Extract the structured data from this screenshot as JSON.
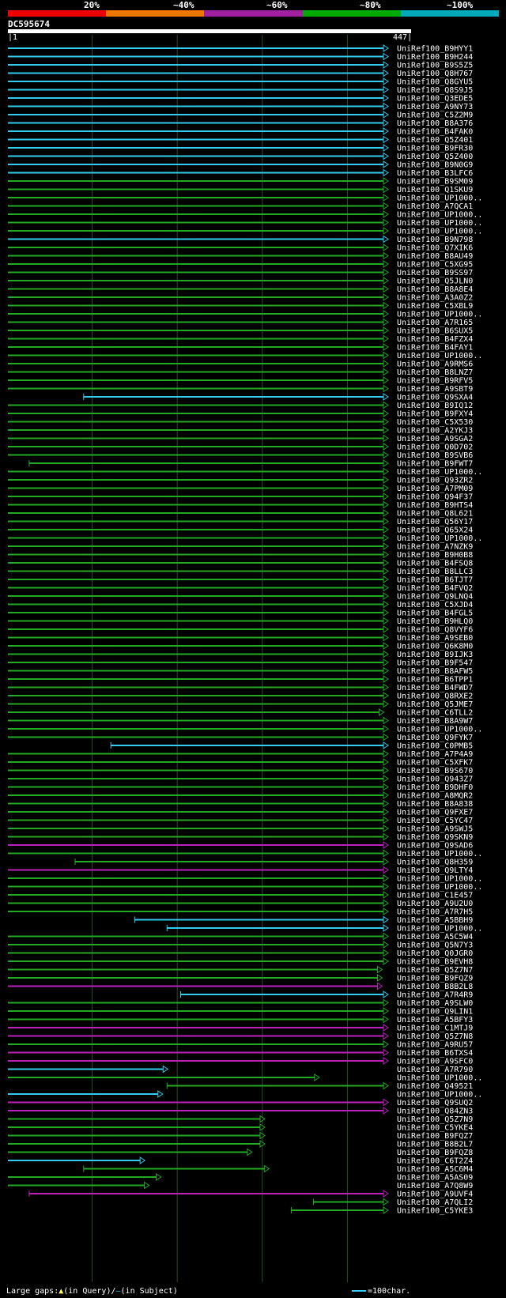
{
  "legend": {
    "labels": [
      "20%",
      "~40%",
      "~60%",
      "~80%",
      "~100%"
    ],
    "colors": [
      "#ee0000",
      "#ee7700",
      "#a020a0",
      "#00aa00",
      "#00aabb"
    ]
  },
  "query": {
    "name": "DC595674",
    "start": "1",
    "end": "447"
  },
  "footer": {
    "gaps_prefix": "Large gaps:",
    "query_marker": "▲",
    "query_text": "(in Query)/",
    "subject_marker": "–",
    "subject_text": "(in Subject)",
    "scale_text": "=100char."
  },
  "chart_data": {
    "type": "alignment-map",
    "query_length": 447,
    "x_ticks": [
      1,
      100,
      200,
      300,
      400,
      447
    ],
    "identity_colors": {
      "cyan": "#33ccee",
      "green": "#22aa22",
      "magenta": "#bb22bb"
    },
    "hits": [
      {
        "name": "UniRef100_B9HYY1",
        "start": 1,
        "end": 447,
        "color": "cyan"
      },
      {
        "name": "UniRef100_B9H244",
        "start": 1,
        "end": 447,
        "color": "cyan"
      },
      {
        "name": "UniRef100_B9S5Z5",
        "start": 1,
        "end": 447,
        "color": "cyan"
      },
      {
        "name": "UniRef100_Q8H767",
        "start": 1,
        "end": 447,
        "color": "cyan"
      },
      {
        "name": "UniRef100_Q8GYU5",
        "start": 1,
        "end": 447,
        "color": "cyan"
      },
      {
        "name": "UniRef100_Q8S9J5",
        "start": 1,
        "end": 447,
        "color": "cyan"
      },
      {
        "name": "UniRef100_Q3EDE5",
        "start": 1,
        "end": 447,
        "color": "cyan"
      },
      {
        "name": "UniRef100_A9NY73",
        "start": 1,
        "end": 447,
        "color": "cyan"
      },
      {
        "name": "UniRef100_C5Z2M9",
        "start": 1,
        "end": 447,
        "color": "cyan"
      },
      {
        "name": "UniRef100_B8A376",
        "start": 1,
        "end": 447,
        "color": "cyan"
      },
      {
        "name": "UniRef100_B4FAK0",
        "start": 1,
        "end": 447,
        "color": "cyan"
      },
      {
        "name": "UniRef100_Q5Z401",
        "start": 1,
        "end": 447,
        "color": "cyan"
      },
      {
        "name": "UniRef100_B9FR30",
        "start": 1,
        "end": 447,
        "color": "cyan"
      },
      {
        "name": "UniRef100_Q5Z400",
        "start": 1,
        "end": 447,
        "color": "cyan"
      },
      {
        "name": "UniRef100_B9N0G9",
        "start": 1,
        "end": 447,
        "color": "cyan"
      },
      {
        "name": "UniRef100_B3LFC6",
        "start": 1,
        "end": 447,
        "color": "cyan"
      },
      {
        "name": "UniRef100_B9SM09",
        "start": 1,
        "end": 447,
        "color": "green"
      },
      {
        "name": "UniRef100_Q1SKU9",
        "start": 1,
        "end": 447,
        "color": "green"
      },
      {
        "name": "UniRef100_UP1000..",
        "start": 1,
        "end": 447,
        "color": "green"
      },
      {
        "name": "UniRef100_A7QCA1",
        "start": 1,
        "end": 447,
        "color": "green"
      },
      {
        "name": "UniRef100_UP1000..",
        "start": 1,
        "end": 447,
        "color": "green"
      },
      {
        "name": "UniRef100_UP1000..",
        "start": 1,
        "end": 447,
        "color": "green"
      },
      {
        "name": "UniRef100_UP1000..",
        "start": 1,
        "end": 447,
        "color": "green"
      },
      {
        "name": "UniRef100_B9N798",
        "start": 1,
        "end": 447,
        "color": "cyan"
      },
      {
        "name": "UniRef100_Q7XIK6",
        "start": 1,
        "end": 447,
        "color": "green"
      },
      {
        "name": "UniRef100_B8AU49",
        "start": 1,
        "end": 447,
        "color": "green"
      },
      {
        "name": "UniRef100_C5XG95",
        "start": 1,
        "end": 447,
        "color": "green"
      },
      {
        "name": "UniRef100_B9SS97",
        "start": 1,
        "end": 447,
        "color": "green"
      },
      {
        "name": "UniRef100_Q5JLN0",
        "start": 1,
        "end": 447,
        "color": "green"
      },
      {
        "name": "UniRef100_B8A8E4",
        "start": 1,
        "end": 447,
        "color": "green"
      },
      {
        "name": "UniRef100_A3A0Z2",
        "start": 1,
        "end": 447,
        "color": "green"
      },
      {
        "name": "UniRef100_C5XBL9",
        "start": 1,
        "end": 447,
        "color": "green"
      },
      {
        "name": "UniRef100_UP1000..",
        "start": 1,
        "end": 447,
        "color": "green"
      },
      {
        "name": "UniRef100_A7R165",
        "start": 1,
        "end": 447,
        "color": "green"
      },
      {
        "name": "UniRef100_B6SUX5",
        "start": 1,
        "end": 447,
        "color": "green"
      },
      {
        "name": "UniRef100_B4FZX4",
        "start": 1,
        "end": 447,
        "color": "green"
      },
      {
        "name": "UniRef100_B4FAY1",
        "start": 1,
        "end": 447,
        "color": "green"
      },
      {
        "name": "UniRef100_UP1000..",
        "start": 1,
        "end": 447,
        "color": "green"
      },
      {
        "name": "UniRef100_A9RMS6",
        "start": 1,
        "end": 447,
        "color": "green"
      },
      {
        "name": "UniRef100_B8LNZ7",
        "start": 1,
        "end": 447,
        "color": "green"
      },
      {
        "name": "UniRef100_B9RFV5",
        "start": 1,
        "end": 447,
        "color": "green"
      },
      {
        "name": "UniRef100_A9SBT9",
        "start": 1,
        "end": 447,
        "color": "green"
      },
      {
        "name": "UniRef100_Q9SXA4",
        "start": 90,
        "end": 447,
        "color": "cyan"
      },
      {
        "name": "UniRef100_B9IQ12",
        "start": 1,
        "end": 447,
        "color": "green"
      },
      {
        "name": "UniRef100_B9FXY4",
        "start": 1,
        "end": 447,
        "color": "green"
      },
      {
        "name": "UniRef100_C5X530",
        "start": 1,
        "end": 447,
        "color": "green"
      },
      {
        "name": "UniRef100_A2YKJ3",
        "start": 1,
        "end": 447,
        "color": "green"
      },
      {
        "name": "UniRef100_A9SGA2",
        "start": 1,
        "end": 447,
        "color": "green"
      },
      {
        "name": "UniRef100_Q0D702",
        "start": 1,
        "end": 447,
        "color": "green"
      },
      {
        "name": "UniRef100_B9SVB6",
        "start": 1,
        "end": 447,
        "color": "green"
      },
      {
        "name": "UniRef100_B9FWT7",
        "start": 26,
        "end": 447,
        "color": "green"
      },
      {
        "name": "UniRef100_UP1000..",
        "start": 1,
        "end": 447,
        "color": "green"
      },
      {
        "name": "UniRef100_Q93ZR2",
        "start": 1,
        "end": 447,
        "color": "green"
      },
      {
        "name": "UniRef100_A7PM09",
        "start": 1,
        "end": 447,
        "color": "green"
      },
      {
        "name": "UniRef100_Q94F37",
        "start": 1,
        "end": 447,
        "color": "green"
      },
      {
        "name": "UniRef100_B9HTS4",
        "start": 1,
        "end": 447,
        "color": "green"
      },
      {
        "name": "UniRef100_Q8L621",
        "start": 1,
        "end": 447,
        "color": "green"
      },
      {
        "name": "UniRef100_Q56Y17",
        "start": 1,
        "end": 447,
        "color": "green"
      },
      {
        "name": "UniRef100_Q65X24",
        "start": 1,
        "end": 447,
        "color": "green"
      },
      {
        "name": "UniRef100_UP1000..",
        "start": 1,
        "end": 447,
        "color": "green"
      },
      {
        "name": "UniRef100_A7NZK9",
        "start": 1,
        "end": 447,
        "color": "green"
      },
      {
        "name": "UniRef100_B9H0B8",
        "start": 1,
        "end": 447,
        "color": "green"
      },
      {
        "name": "UniRef100_B4FSQ8",
        "start": 1,
        "end": 447,
        "color": "green"
      },
      {
        "name": "UniRef100_B8LLC3",
        "start": 1,
        "end": 447,
        "color": "green"
      },
      {
        "name": "UniRef100_B6TJT7",
        "start": 1,
        "end": 447,
        "color": "green"
      },
      {
        "name": "UniRef100_B4FVQ2",
        "start": 1,
        "end": 447,
        "color": "green"
      },
      {
        "name": "UniRef100_Q9LNQ4",
        "start": 1,
        "end": 447,
        "color": "green"
      },
      {
        "name": "UniRef100_C5XJD4",
        "start": 1,
        "end": 447,
        "color": "green"
      },
      {
        "name": "UniRef100_B4FGL5",
        "start": 1,
        "end": 447,
        "color": "green"
      },
      {
        "name": "UniRef100_B9HLQ0",
        "start": 1,
        "end": 447,
        "color": "green"
      },
      {
        "name": "UniRef100_Q8VYF6",
        "start": 1,
        "end": 447,
        "color": "green"
      },
      {
        "name": "UniRef100_A9SEB0",
        "start": 1,
        "end": 447,
        "color": "green"
      },
      {
        "name": "UniRef100_Q6K8M0",
        "start": 1,
        "end": 447,
        "color": "green"
      },
      {
        "name": "UniRef100_B9IJK3",
        "start": 1,
        "end": 447,
        "color": "green"
      },
      {
        "name": "UniRef100_B9F547",
        "start": 1,
        "end": 447,
        "color": "green"
      },
      {
        "name": "UniRef100_B8AFW5",
        "start": 1,
        "end": 447,
        "color": "green"
      },
      {
        "name": "UniRef100_B6TPP1",
        "start": 1,
        "end": 447,
        "color": "green"
      },
      {
        "name": "UniRef100_B4FWD7",
        "start": 1,
        "end": 447,
        "color": "green"
      },
      {
        "name": "UniRef100_Q8RXE2",
        "start": 1,
        "end": 447,
        "color": "green"
      },
      {
        "name": "UniRef100_Q5JME7",
        "start": 1,
        "end": 447,
        "color": "green"
      },
      {
        "name": "UniRef100_C6TLL2",
        "start": 1,
        "end": 442,
        "color": "green"
      },
      {
        "name": "UniRef100_B8A9W7",
        "start": 1,
        "end": 447,
        "color": "green"
      },
      {
        "name": "UniRef100_UP1000..",
        "start": 1,
        "end": 447,
        "color": "green"
      },
      {
        "name": "UniRef100_Q9FYK7",
        "start": 1,
        "end": 447,
        "color": "green"
      },
      {
        "name": "UniRef100_C0PMB5",
        "start": 122,
        "end": 447,
        "color": "cyan"
      },
      {
        "name": "UniRef100_A7P4A9",
        "start": 1,
        "end": 447,
        "color": "green"
      },
      {
        "name": "UniRef100_C5XFK7",
        "start": 1,
        "end": 447,
        "color": "green"
      },
      {
        "name": "UniRef100_B9S670",
        "start": 1,
        "end": 447,
        "color": "green"
      },
      {
        "name": "UniRef100_Q943Z7",
        "start": 1,
        "end": 447,
        "color": "green"
      },
      {
        "name": "UniRef100_B9DHF0",
        "start": 1,
        "end": 447,
        "color": "green"
      },
      {
        "name": "UniRef100_A8MQR2",
        "start": 1,
        "end": 447,
        "color": "green"
      },
      {
        "name": "UniRef100_B8A838",
        "start": 1,
        "end": 447,
        "color": "green"
      },
      {
        "name": "UniRef100_Q9FXE7",
        "start": 1,
        "end": 447,
        "color": "green"
      },
      {
        "name": "UniRef100_C5YC47",
        "start": 1,
        "end": 447,
        "color": "green"
      },
      {
        "name": "UniRef100_A9SWJ5",
        "start": 1,
        "end": 447,
        "color": "green"
      },
      {
        "name": "UniRef100_Q9SKN9",
        "start": 1,
        "end": 447,
        "color": "green"
      },
      {
        "name": "UniRef100_Q9SAD6",
        "start": 1,
        "end": 447,
        "color": "magenta"
      },
      {
        "name": "UniRef100_UP1000..",
        "start": 1,
        "end": 447,
        "color": "green"
      },
      {
        "name": "UniRef100_Q8H359",
        "start": 80,
        "end": 447,
        "color": "green"
      },
      {
        "name": "UniRef100_Q9LTY4",
        "start": 1,
        "end": 447,
        "color": "magenta"
      },
      {
        "name": "UniRef100_UP1000..",
        "start": 1,
        "end": 447,
        "color": "green"
      },
      {
        "name": "UniRef100_UP1000..",
        "start": 1,
        "end": 447,
        "color": "green"
      },
      {
        "name": "UniRef100_C1E457",
        "start": 1,
        "end": 447,
        "color": "green"
      },
      {
        "name": "UniRef100_A9U2U0",
        "start": 1,
        "end": 447,
        "color": "green"
      },
      {
        "name": "UniRef100_A7R7H5",
        "start": 1,
        "end": 447,
        "color": "green"
      },
      {
        "name": "UniRef100_A5BBH9",
        "start": 150,
        "end": 447,
        "color": "cyan"
      },
      {
        "name": "UniRef100_UP1000..",
        "start": 188,
        "end": 447,
        "color": "cyan"
      },
      {
        "name": "UniRef100_A5C5W4",
        "start": 1,
        "end": 447,
        "color": "green"
      },
      {
        "name": "UniRef100_Q5N7Y3",
        "start": 1,
        "end": 447,
        "color": "green"
      },
      {
        "name": "UniRef100_Q0JGR0",
        "start": 1,
        "end": 447,
        "color": "green"
      },
      {
        "name": "UniRef100_B9EVH8",
        "start": 1,
        "end": 447,
        "color": "green"
      },
      {
        "name": "UniRef100_Q5Z7N7",
        "start": 1,
        "end": 440,
        "color": "green"
      },
      {
        "name": "UniRef100_B9FQZ9",
        "start": 1,
        "end": 440,
        "color": "green"
      },
      {
        "name": "UniRef100_B8B2L8",
        "start": 1,
        "end": 440,
        "color": "magenta"
      },
      {
        "name": "UniRef100_A7R4R9",
        "start": 204,
        "end": 447,
        "color": "cyan"
      },
      {
        "name": "UniRef100_A9SLW0",
        "start": 1,
        "end": 447,
        "color": "green"
      },
      {
        "name": "UniRef100_Q9LIN1",
        "start": 1,
        "end": 447,
        "color": "green"
      },
      {
        "name": "UniRef100_A5BFY3",
        "start": 1,
        "end": 447,
        "color": "green"
      },
      {
        "name": "UniRef100_C1MTJ9",
        "start": 1,
        "end": 447,
        "color": "magenta"
      },
      {
        "name": "UniRef100_Q5Z7N8",
        "start": 1,
        "end": 447,
        "color": "magenta"
      },
      {
        "name": "UniRef100_A9RU57",
        "start": 1,
        "end": 447,
        "color": "green"
      },
      {
        "name": "UniRef100_B6TXS4",
        "start": 1,
        "end": 447,
        "color": "magenta"
      },
      {
        "name": "UniRef100_A9SFC0",
        "start": 1,
        "end": 447,
        "color": "magenta"
      },
      {
        "name": "UniRef100_A7R790",
        "start": 1,
        "end": 188,
        "color": "cyan"
      },
      {
        "name": "UniRef100_UP1000..",
        "start": 1,
        "end": 366,
        "color": "green"
      },
      {
        "name": "UniRef100_Q49521",
        "start": 188,
        "end": 447,
        "color": "green"
      },
      {
        "name": "UniRef100_UP1000..",
        "start": 1,
        "end": 182,
        "color": "cyan"
      },
      {
        "name": "UniRef100_Q9SUQ2",
        "start": 1,
        "end": 447,
        "color": "magenta"
      },
      {
        "name": "UniRef100_Q84ZN3",
        "start": 1,
        "end": 447,
        "color": "magenta"
      },
      {
        "name": "UniRef100_Q5Z7N9",
        "start": 1,
        "end": 302,
        "color": "green"
      },
      {
        "name": "UniRef100_C5YKE4",
        "start": 1,
        "end": 302,
        "color": "green"
      },
      {
        "name": "UniRef100_B9FQZ7",
        "start": 1,
        "end": 302,
        "color": "green"
      },
      {
        "name": "UniRef100_B8B2L7",
        "start": 1,
        "end": 302,
        "color": "green"
      },
      {
        "name": "UniRef100_B9FQZ8",
        "start": 1,
        "end": 287,
        "color": "green"
      },
      {
        "name": "UniRef100_C6T2Z4",
        "start": 1,
        "end": 161,
        "color": "cyan"
      },
      {
        "name": "UniRef100_A5C6M4",
        "start": 90,
        "end": 307,
        "color": "green"
      },
      {
        "name": "UniRef100_A5AS09",
        "start": 1,
        "end": 180,
        "color": "green"
      },
      {
        "name": "UniRef100_A7Q8W9",
        "start": 1,
        "end": 166,
        "color": "green"
      },
      {
        "name": "UniRef100_A9UVF4",
        "start": 26,
        "end": 447,
        "color": "magenta"
      },
      {
        "name": "UniRef100_A7QLI2",
        "start": 360,
        "end": 447,
        "color": "green"
      },
      {
        "name": "UniRef100_C5YKE3",
        "start": 334,
        "end": 447,
        "color": "green"
      }
    ]
  }
}
